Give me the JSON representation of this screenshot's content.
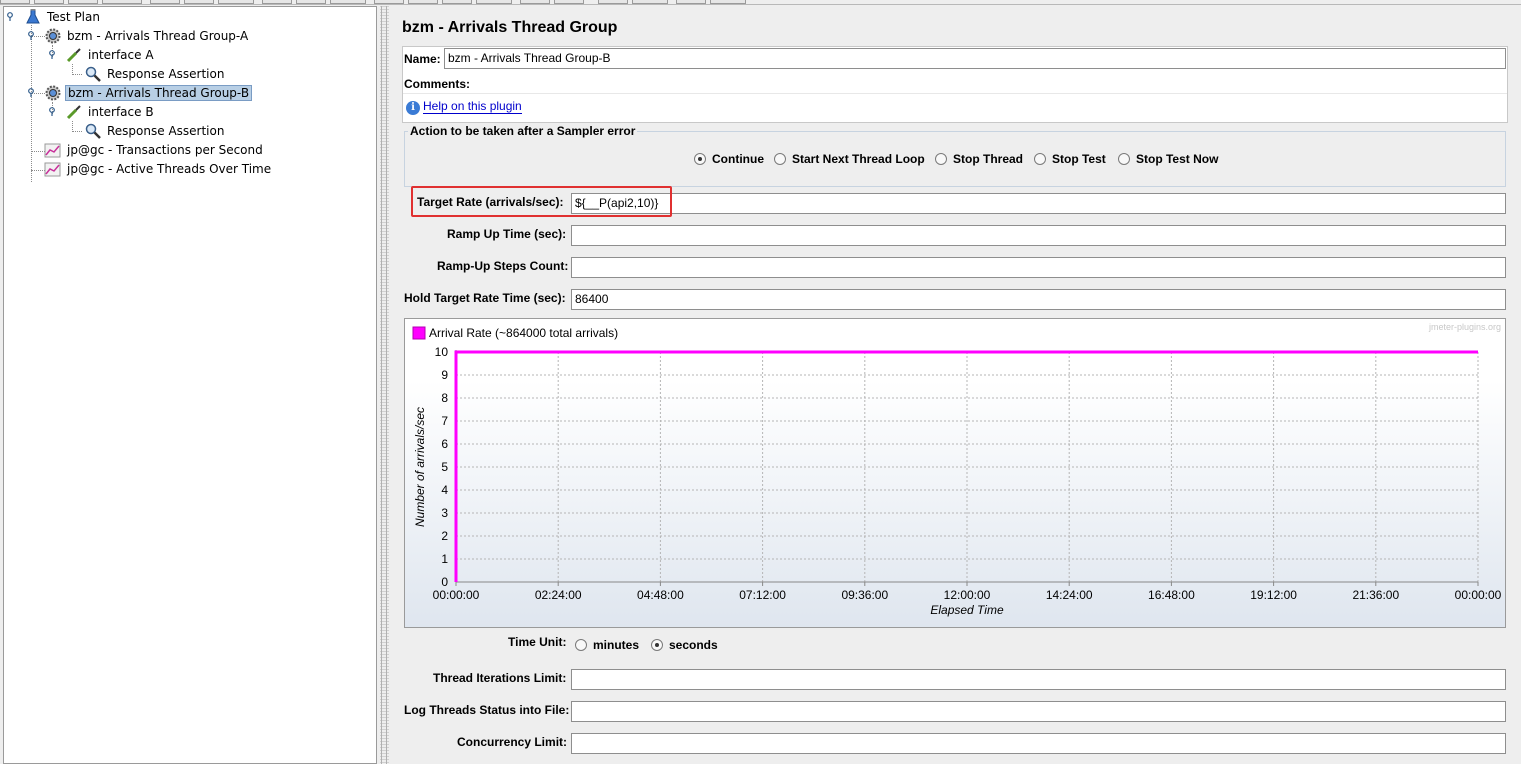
{
  "tree": {
    "items": [
      {
        "label": "Test Plan",
        "icon": "flask-icon"
      },
      {
        "label": "bzm - Arrivals Thread Group-A",
        "icon": "gear-icon"
      },
      {
        "label": "interface A",
        "icon": "pipette-icon"
      },
      {
        "label": "Response Assertion",
        "icon": "magnifier-icon"
      },
      {
        "label": "bzm - Arrivals Thread Group-B",
        "icon": "gear-icon",
        "selected": true
      },
      {
        "label": "interface B",
        "icon": "pipette-icon"
      },
      {
        "label": "Response Assertion",
        "icon": "magnifier-icon"
      },
      {
        "label": "jp@gc - Transactions per Second",
        "icon": "graph-icon"
      },
      {
        "label": "jp@gc - Active Threads Over Time",
        "icon": "graph-icon"
      }
    ]
  },
  "panel": {
    "title": "bzm - Arrivals Thread Group",
    "name_label": "Name:",
    "name_value": "bzm - Arrivals Thread Group-B",
    "comments_label": "Comments:",
    "help_link": "Help on this plugin",
    "action_title": "Action to be taken after a Sampler error",
    "actions": [
      {
        "label": "Continue",
        "checked": true
      },
      {
        "label": "Start Next Thread Loop",
        "checked": false
      },
      {
        "label": "Stop Thread",
        "checked": false
      },
      {
        "label": "Stop Test",
        "checked": false
      },
      {
        "label": "Stop Test Now",
        "checked": false
      }
    ],
    "target_rate_label": "Target Rate (arrivals/sec):",
    "target_rate_value": "${__P(api2,10)}",
    "ramp_up_label": "Ramp Up Time (sec):",
    "ramp_up_value": "",
    "ramp_steps_label": "Ramp-Up Steps Count:",
    "ramp_steps_value": "",
    "hold_label": "Hold Target Rate Time (sec):",
    "hold_value": "86400",
    "time_unit_label": "Time Unit:",
    "time_units": [
      {
        "label": "minutes",
        "checked": false
      },
      {
        "label": "seconds",
        "checked": true
      }
    ],
    "iter_limit_label": "Thread Iterations Limit:",
    "iter_limit_value": "",
    "log_label": "Log Threads Status into File:",
    "log_value": "",
    "concurrency_label": "Concurrency Limit:",
    "concurrency_value": ""
  },
  "chart_data": {
    "type": "line",
    "watermark": "jmeter-plugins.org",
    "ylabel": "Number of arrivals/sec",
    "xlabel": "Elapsed Time",
    "ylim": [
      0,
      10
    ],
    "yticks": [
      "0",
      "1",
      "2",
      "3",
      "4",
      "5",
      "6",
      "7",
      "8",
      "9",
      "10"
    ],
    "xticks": [
      "00:00:00",
      "02:24:00",
      "04:48:00",
      "07:12:00",
      "09:36:00",
      "12:00:00",
      "14:24:00",
      "16:48:00",
      "19:12:00",
      "21:36:00",
      "00:00:00"
    ],
    "grid": true,
    "legend_placement": "top-left",
    "series": [
      {
        "name": "Arrival Rate (~864000 total arrivals)",
        "color": "#ff00ff",
        "points": [
          {
            "x": 0,
            "y": 0
          },
          {
            "x": 0,
            "y": 10
          },
          {
            "x": 86400,
            "y": 10
          }
        ]
      }
    ],
    "xlim": [
      0,
      86400
    ]
  }
}
